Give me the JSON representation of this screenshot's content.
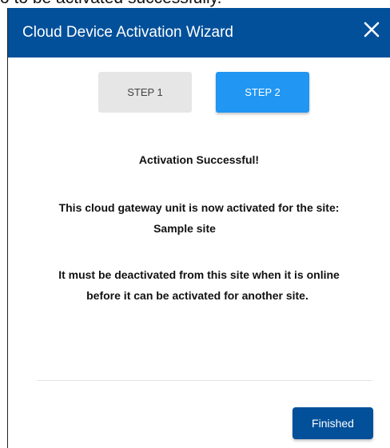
{
  "background": {
    "text": "o to be activated successfully."
  },
  "dialog": {
    "title": "Cloud Device Activation Wizard",
    "close_icon": "close-icon",
    "header_color": "#02509a"
  },
  "steps": [
    {
      "label": "STEP 1",
      "active": false
    },
    {
      "label": "STEP 2",
      "active": true
    }
  ],
  "messages": {
    "title": "Activation Successful!",
    "line1": "This cloud gateway unit is now activated for the site:",
    "site_name": "Sample site",
    "line3": "It must be deactivated from this site when it is online",
    "line4": "before it can be activated for another site."
  },
  "footer": {
    "finished_label": "Finished"
  },
  "colors": {
    "accent": "#2196f3",
    "primary": "#02509a",
    "inactive_step": "#e6e6e6"
  }
}
